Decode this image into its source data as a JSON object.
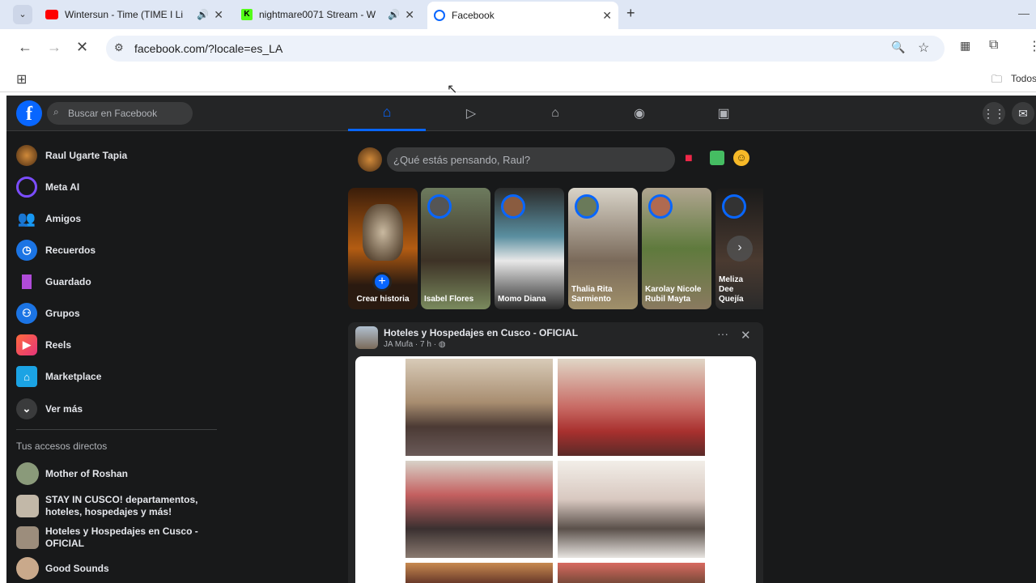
{
  "browser": {
    "tabs": [
      {
        "label": "Wintersun - Time (TIME I Li",
        "audio": "sound-icon"
      },
      {
        "label": "nightmare0071 Stream - W",
        "audio": "sound-icon"
      },
      {
        "label": "Facebook"
      }
    ],
    "new_tab": "+",
    "url": "facebook.com/?locale=es_LA",
    "bookmarks_folder": "Todos"
  },
  "facebook": {
    "search_placeholder": "Buscar en Facebook",
    "sidebar": {
      "items": [
        {
          "label": "Raul Ugarte Tapia",
          "icon": "profile-avatar"
        },
        {
          "label": "Meta AI",
          "icon": "meta-ai-icon"
        },
        {
          "label": "Amigos",
          "icon": "friends-icon"
        },
        {
          "label": "Recuerdos",
          "icon": "clock-icon"
        },
        {
          "label": "Guardado",
          "icon": "bookmark-icon"
        },
        {
          "label": "Grupos",
          "icon": "groups-icon"
        },
        {
          "label": "Reels",
          "icon": "reels-icon"
        },
        {
          "label": "Marketplace",
          "icon": "store-icon"
        },
        {
          "label": "Ver más",
          "icon": "chevron-down-icon"
        }
      ],
      "shortcuts_title": "Tus accesos directos",
      "shortcuts": [
        {
          "label": "Mother of Roshan"
        },
        {
          "label": "STAY IN CUSCO! departamentos, hoteles, hospedajes y más!"
        },
        {
          "label": "Hoteles y Hospedajes en Cusco - OFICIAL"
        },
        {
          "label": "Good Sounds"
        }
      ]
    },
    "composer_placeholder": "¿Qué estás pensando, Raul?",
    "stories": [
      {
        "name": "Crear historia"
      },
      {
        "name": "Isabel Flores"
      },
      {
        "name": "Momo Diana"
      },
      {
        "name": "Thalia Rita Sarmiento"
      },
      {
        "name": "Karolay Nicole Rubil Mayta"
      },
      {
        "name": "Meliza Dee Quejía"
      }
    ],
    "post": {
      "title": "Hoteles y Hospedajes en Cusco - OFICIAL",
      "meta": "JA Mufa · 7 h ·"
    }
  }
}
